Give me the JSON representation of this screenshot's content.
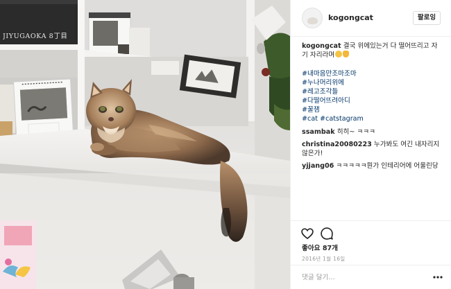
{
  "post": {
    "photo_alt": "cat on shelf",
    "book_spine_text": "JIYUGAOKA 8丁目"
  },
  "header": {
    "username": "kogongcat",
    "follow_label": "팔로잉"
  },
  "caption": {
    "username": "kogongcat",
    "text": "결국 위에있는거 다 떨어뜨리고 자기 자리라며",
    "emojis": [
      "smiling-cat-face",
      "ok-hand"
    ],
    "hashtags": [
      "#내마음만조마조마",
      "#누나머리위에",
      "#레고조각들",
      "#다떨어뜨려아디",
      "#꿀잼"
    ],
    "last_line_tags": [
      "#cat",
      "#catstagram"
    ]
  },
  "comments": [
    {
      "username": "ssambak",
      "text": "히히~ ㅋㅋㅋ"
    },
    {
      "username": "christina20080223",
      "text": "누가봐도 여긴 내자리지않은가!"
    },
    {
      "username": "yjjang06",
      "text": "ㅋㅋㅋㅋㅋ뭔가 인테리어에 어울린당"
    }
  ],
  "actions": {
    "like_icon": "heart-icon",
    "comment_icon": "speech-bubble-icon",
    "likes_label": "좋아요 87개",
    "date": "2016년 1월 16일"
  },
  "comment_box": {
    "placeholder": "댓글 달기...",
    "more_icon": "ellipsis-icon"
  },
  "colors": {
    "hashtag": "#003569",
    "border": "#efefef",
    "text": "#262626",
    "muted": "#999999"
  }
}
